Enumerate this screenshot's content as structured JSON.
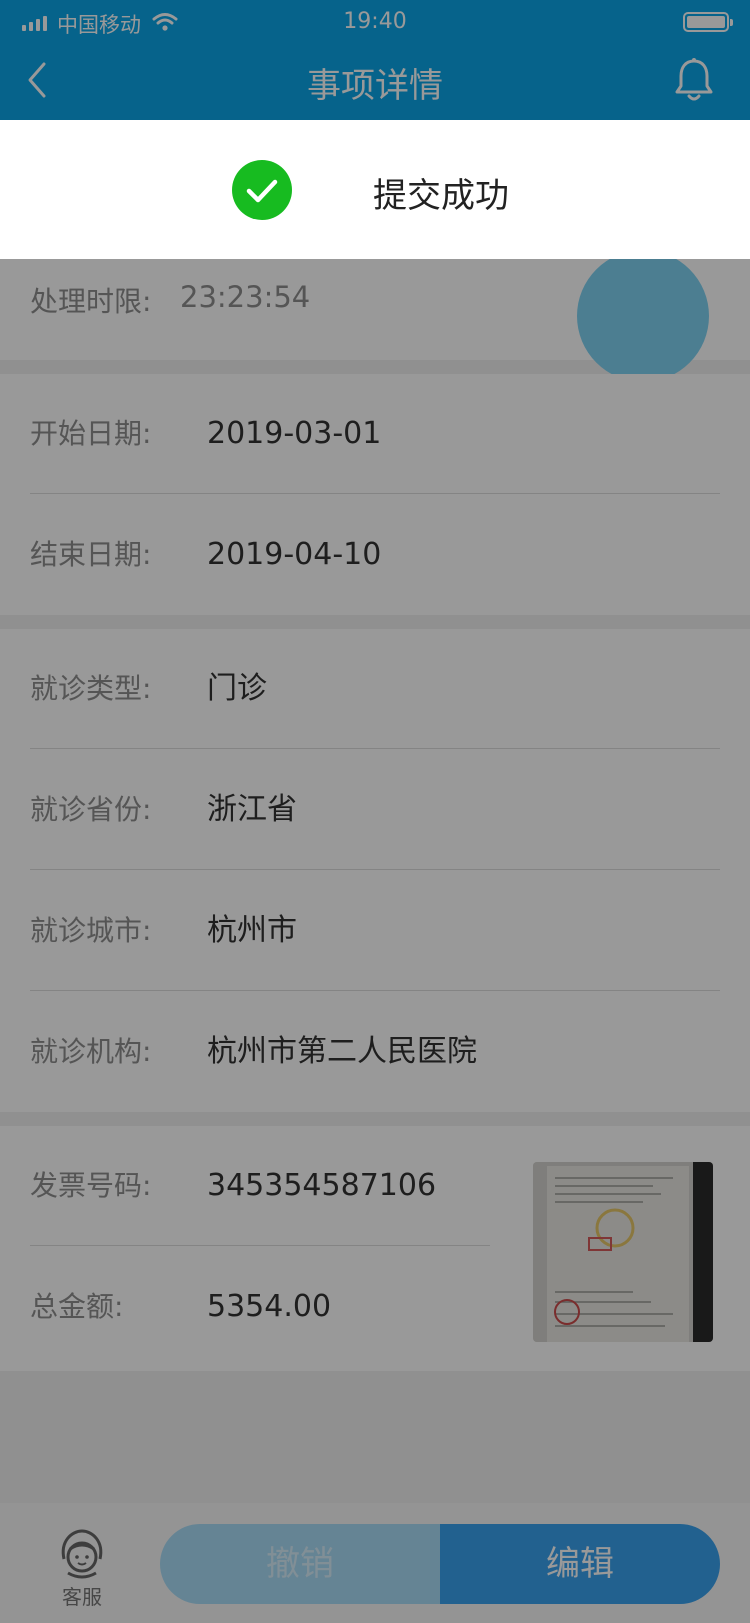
{
  "status_bar": {
    "carrier": "中国移动",
    "time": "19:40"
  },
  "nav": {
    "title": "事项详情"
  },
  "deadline": {
    "label": "处理时限:",
    "value": "23:23:54"
  },
  "dates": {
    "start_label": "开始日期:",
    "start_value": "2019-03-01",
    "end_label": "结束日期:",
    "end_value": "2019-04-10"
  },
  "visit": {
    "type_label": "就诊类型:",
    "type_value": "门诊",
    "province_label": "就诊省份:",
    "province_value": "浙江省",
    "city_label": "就诊城市:",
    "city_value": "杭州市",
    "org_label": "就诊机构:",
    "org_value": "杭州市第二人民医院"
  },
  "invoice": {
    "number_label": "发票号码:",
    "number_value": "345354587106",
    "amount_label": "总金额:",
    "amount_value": "5354.00"
  },
  "bottom": {
    "service_label": "客服",
    "cancel_label": "撤销",
    "edit_label": "编辑"
  },
  "toast": {
    "message": "提交成功"
  },
  "colors": {
    "brand_blue": "#0aa6e8",
    "success_green": "#17bb20",
    "edit_button": "#3aa2ee"
  }
}
